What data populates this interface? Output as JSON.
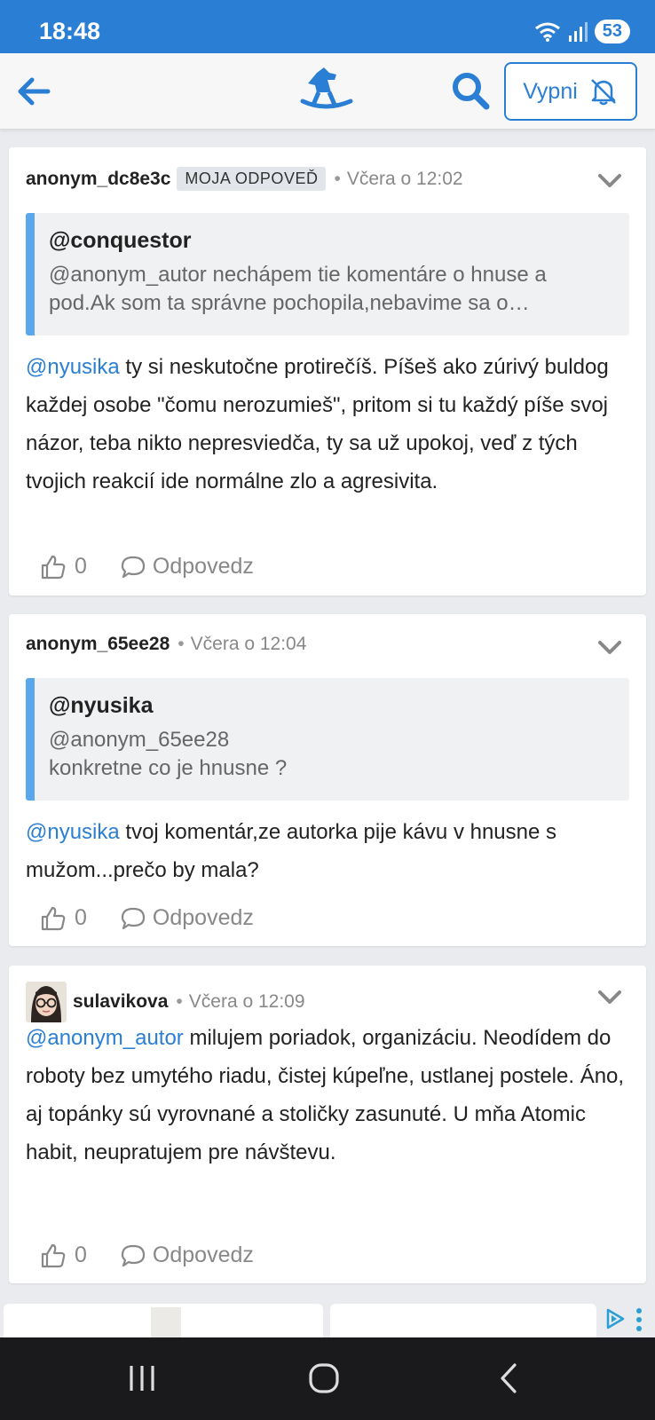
{
  "status_bar": {
    "time": "18:48",
    "battery": "53"
  },
  "header": {
    "mute_label": "Vypni"
  },
  "comments": [
    {
      "author": "anonym_dc8e3c",
      "badge": "MOJA ODPOVEĎ",
      "time": "Včera o 12:02",
      "quote": {
        "author": "@conquestor",
        "text": "@anonym_autor nechápem tie komentáre o hnuse a pod.Ak som ta správne pochopila,nebavime sa o…"
      },
      "mention": "@nyusika",
      "text": " ty si neskutočne protirečíš. Píšeš ako zúrivý buldog každej osobe \"čomu nerozumieš\", pritom si tu každý píše svoj názor, teba nikto nepresviedča, ty sa už upokoj, veď z tých tvojich reakcií ide normálne zlo a agresivita.",
      "likes": "0",
      "reply_label": "Odpovedz"
    },
    {
      "author": "anonym_65ee28",
      "time": "Včera o 12:04",
      "quote": {
        "author": "@nyusika",
        "text_line1": "@anonym_65ee28",
        "text_line2": "konkretne co je hnusne ?"
      },
      "mention": "@nyusika",
      "text": " tvoj komentár,ze autorka pije kávu v hnusne s mužom...prečo by mala?",
      "likes": "0",
      "reply_label": "Odpovedz"
    },
    {
      "author": "sulavikova",
      "time": "Včera o 12:09",
      "mention": "@anonym_autor",
      "text": " milujem poriadok, organizáciu. Neodídem do roboty bez umytého riadu, čistej kúpeľne, ustlanej postele. Áno, aj topánky sú vyrovnané a stoličky zasunuté. U mňa Atomic habit, neupratujem pre návštevu.",
      "likes": "0",
      "reply_label": "Odpovedz"
    }
  ],
  "colors": {
    "accent": "#2a7fd4",
    "quote_bar": "#5aa8ec",
    "status_bar": "#2a7fd4"
  }
}
